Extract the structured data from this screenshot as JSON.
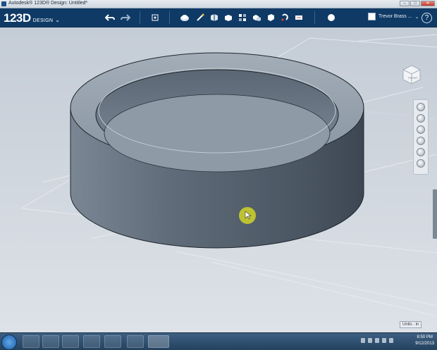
{
  "window": {
    "title": "Autodesk® 123D® Design: Untitled*"
  },
  "brand": {
    "big": "123D",
    "small": "DESIGN"
  },
  "toolbar": {
    "tools": [
      "undo-icon",
      "redo-icon",
      "snap-icon",
      "primitives-icon",
      "sketch-icon",
      "construct-icon",
      "modify-icon",
      "pattern-icon",
      "grouping-icon",
      "combine-icon",
      "measure-icon",
      "text-icon",
      "material-icon"
    ],
    "user_name": "Trevor Brass ...",
    "help_label": "?"
  },
  "viewcube": {
    "face_label": "FRONT"
  },
  "units": {
    "label": "Units : in"
  },
  "taskbar": {
    "time": "8:50 PM",
    "date": "9/12/2013"
  },
  "colors": {
    "toolbar_bg": "#0f3a66",
    "model_body": "#5e6a77",
    "cursor_highlight": "#c9cd2a"
  }
}
